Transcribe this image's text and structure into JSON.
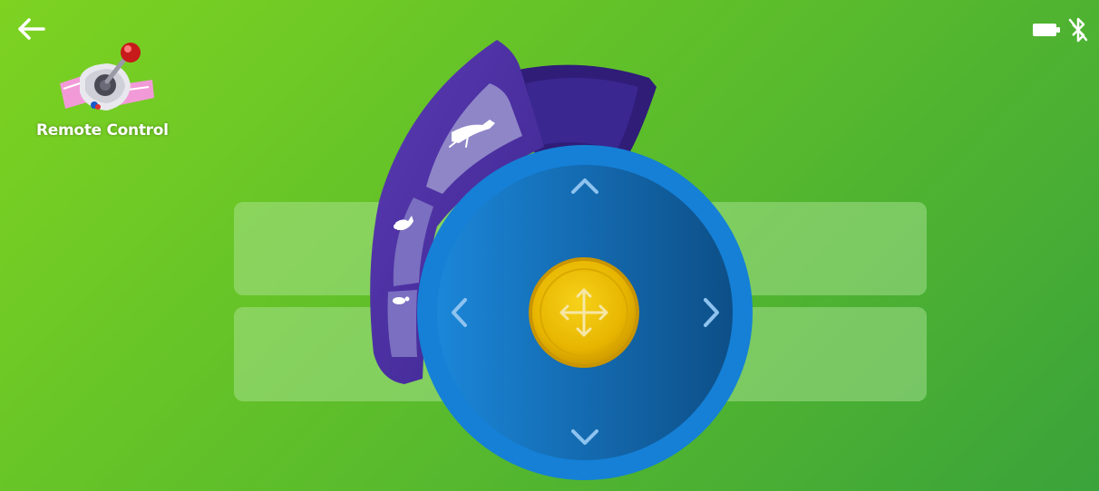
{
  "header": {
    "back_icon": "arrow-left-icon",
    "battery_icon": "battery-icon",
    "bluetooth_icon": "bluetooth-disabled-icon"
  },
  "app": {
    "label": "Remote Control",
    "icon": "joystick-icon"
  },
  "speed_selector": {
    "levels": [
      {
        "name": "fast",
        "icon": "cheetah-icon"
      },
      {
        "name": "medium",
        "icon": "rabbit-icon"
      },
      {
        "name": "slow",
        "icon": "turtle-icon"
      }
    ],
    "selected": "fast"
  },
  "dpad": {
    "up_icon": "chevron-up-icon",
    "down_icon": "chevron-down-icon",
    "left_icon": "chevron-left-icon",
    "right_icon": "chevron-right-icon",
    "center_icon": "move-arrows-icon"
  },
  "colors": {
    "background_start": "#7ed321",
    "background_end": "#3aa33a",
    "dial_blue": "#1478c8",
    "dial_dark": "#0f4f8a",
    "speed_purple": "#4b2fa0",
    "speed_active": "#8f86c8",
    "center_gold": "#f2c400"
  }
}
